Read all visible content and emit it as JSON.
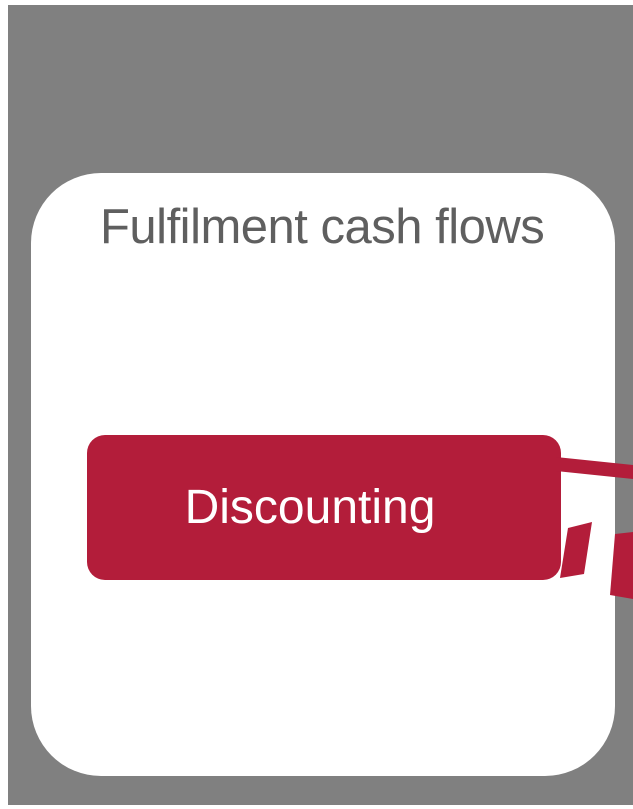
{
  "diagram": {
    "panel_title": "Fulfilment cash flows",
    "discount_label": "Discounting",
    "colors": {
      "background": "#808080",
      "panel": "#ffffff",
      "title_text": "#5f5f5f",
      "accent": "#b31d3a",
      "label_text": "#ffffff"
    }
  }
}
